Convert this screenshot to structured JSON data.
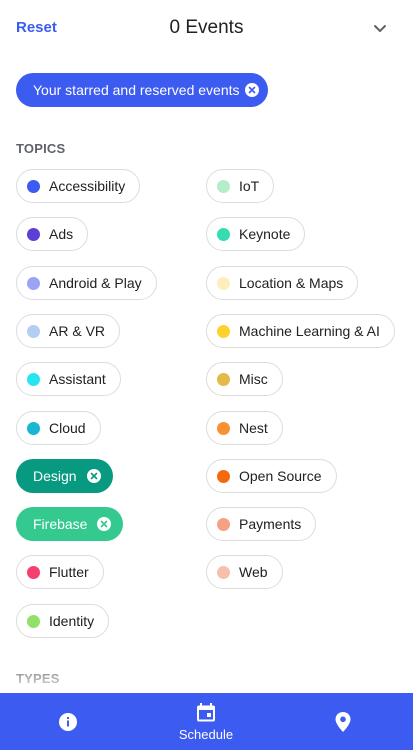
{
  "header": {
    "reset_label": "Reset",
    "title": "0 Events",
    "collapse_icon": "chevron-down-icon"
  },
  "starred_filter": {
    "label": "Your starred and reserved events",
    "clear_icon": "close-icon"
  },
  "sections": {
    "topics_label": "TOPICS",
    "types_label": "TYPES"
  },
  "topics": [
    {
      "label": "Accessibility",
      "color": "#3c5bf0",
      "selected": false
    },
    {
      "label": "IoT",
      "color": "#b5ecc9",
      "selected": false
    },
    {
      "label": "Ads",
      "color": "#5b3fd6",
      "selected": false
    },
    {
      "label": "Keynote",
      "color": "#33ddb0",
      "selected": false
    },
    {
      "label": "Android & Play",
      "color": "#9aa4f6",
      "selected": false
    },
    {
      "label": "Location & Maps",
      "color": "#fdeebb",
      "selected": false
    },
    {
      "label": "AR & VR",
      "color": "#b4cdf2",
      "selected": false
    },
    {
      "label": "Machine Learning & AI",
      "color": "#fdd22c",
      "selected": false
    },
    {
      "label": "Assistant",
      "color": "#28e3f0",
      "selected": false
    },
    {
      "label": "Misc",
      "color": "#e3b948",
      "selected": false
    },
    {
      "label": "Cloud",
      "color": "#17b7d2",
      "selected": false
    },
    {
      "label": "Nest",
      "color": "#f79132",
      "selected": false
    },
    {
      "label": "Design",
      "color": "#089a80",
      "selected": true
    },
    {
      "label": "Open Source",
      "color": "#f5680c",
      "selected": false
    },
    {
      "label": "Firebase",
      "color": "#34c98e",
      "selected": true
    },
    {
      "label": "Payments",
      "color": "#f6a086",
      "selected": false
    },
    {
      "label": "Flutter",
      "color": "#f43f6f",
      "selected": false
    },
    {
      "label": "Web",
      "color": "#f7c0ac",
      "selected": false
    },
    {
      "label": "Identity",
      "color": "#90e06a",
      "selected": false
    }
  ],
  "bottom_nav": {
    "background": "#3c5bf0",
    "items": [
      {
        "icon": "info-icon",
        "label": ""
      },
      {
        "icon": "calendar-icon",
        "label": "Schedule"
      },
      {
        "icon": "map-pin-icon",
        "label": ""
      }
    ]
  }
}
